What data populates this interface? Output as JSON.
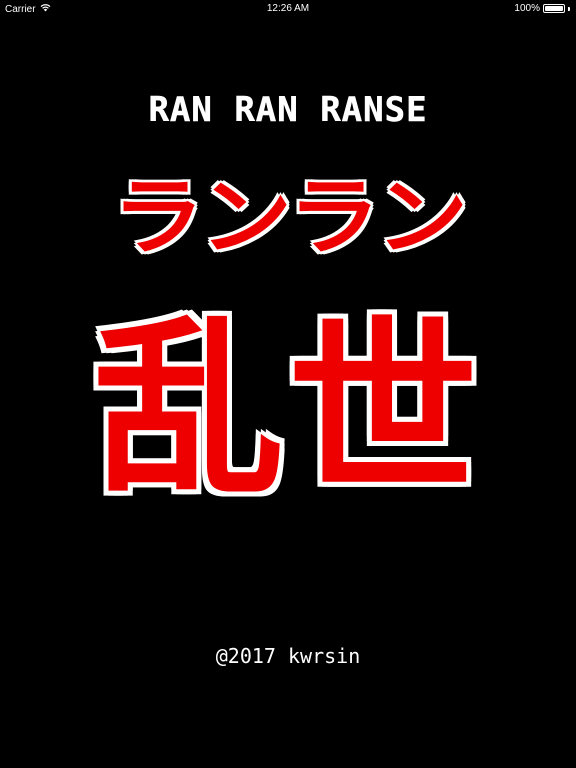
{
  "status_bar": {
    "carrier": "Carrier",
    "time": "12:26 AM",
    "battery_text": "100%",
    "battery_level": 1.0,
    "wifi_icon": "wifi-icon",
    "battery_icon": "battery-icon"
  },
  "title": {
    "subtitle": "RAN RAN RANSE",
    "kana": "ランラン",
    "kanji": "乱世"
  },
  "footer": {
    "copyright": "@2017 kwrsin"
  },
  "colors": {
    "background": "#000000",
    "title_red": "#ee0000",
    "outline": "#ffffff"
  }
}
